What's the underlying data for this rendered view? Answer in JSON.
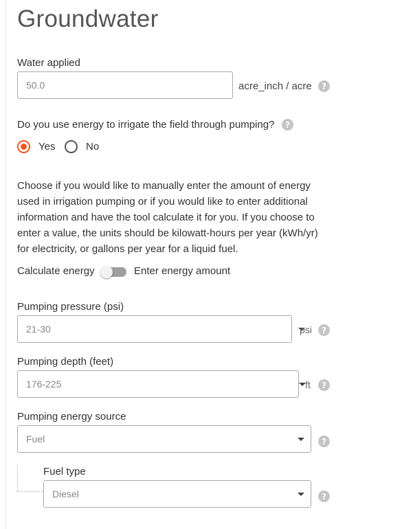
{
  "section": {
    "title": "Groundwater"
  },
  "water_applied": {
    "label": "Water applied",
    "value": "50.0",
    "unit": "acre_inch / acre"
  },
  "energy_question": {
    "question": "Do you use energy to irrigate the field through pumping?",
    "options": [
      "Yes",
      "No"
    ],
    "selected": "Yes"
  },
  "energy_info": {
    "lines": [
      "Choose if you would like to manually enter the amount of energy",
      "used in irrigation pumping or if you would like to enter additional",
      "information and have the tool calculate it for you. If you choose to",
      "enter a value, the units should be kilowatt-hours per year (kWh/yr)",
      "for electricity, or gallons per year for a liquid fuel."
    ]
  },
  "energy_mode": {
    "left_label": "Calculate energy",
    "right_label": "Enter energy amount",
    "on": false
  },
  "pumping_pressure": {
    "label": "Pumping pressure (psi)",
    "value": "21-30",
    "unit": "psi"
  },
  "pumping_depth": {
    "label": "Pumping depth (feet)",
    "value": "176-225",
    "unit": "ft"
  },
  "energy_source": {
    "label": "Pumping energy source",
    "value": "Fuel"
  },
  "fuel_type": {
    "label": "Fuel type",
    "value": "Diesel"
  },
  "help_glyph": "?",
  "colors": {
    "accent": "#e85a25",
    "help_bg": "#c4c4c4",
    "border": "#a8a8a8"
  }
}
